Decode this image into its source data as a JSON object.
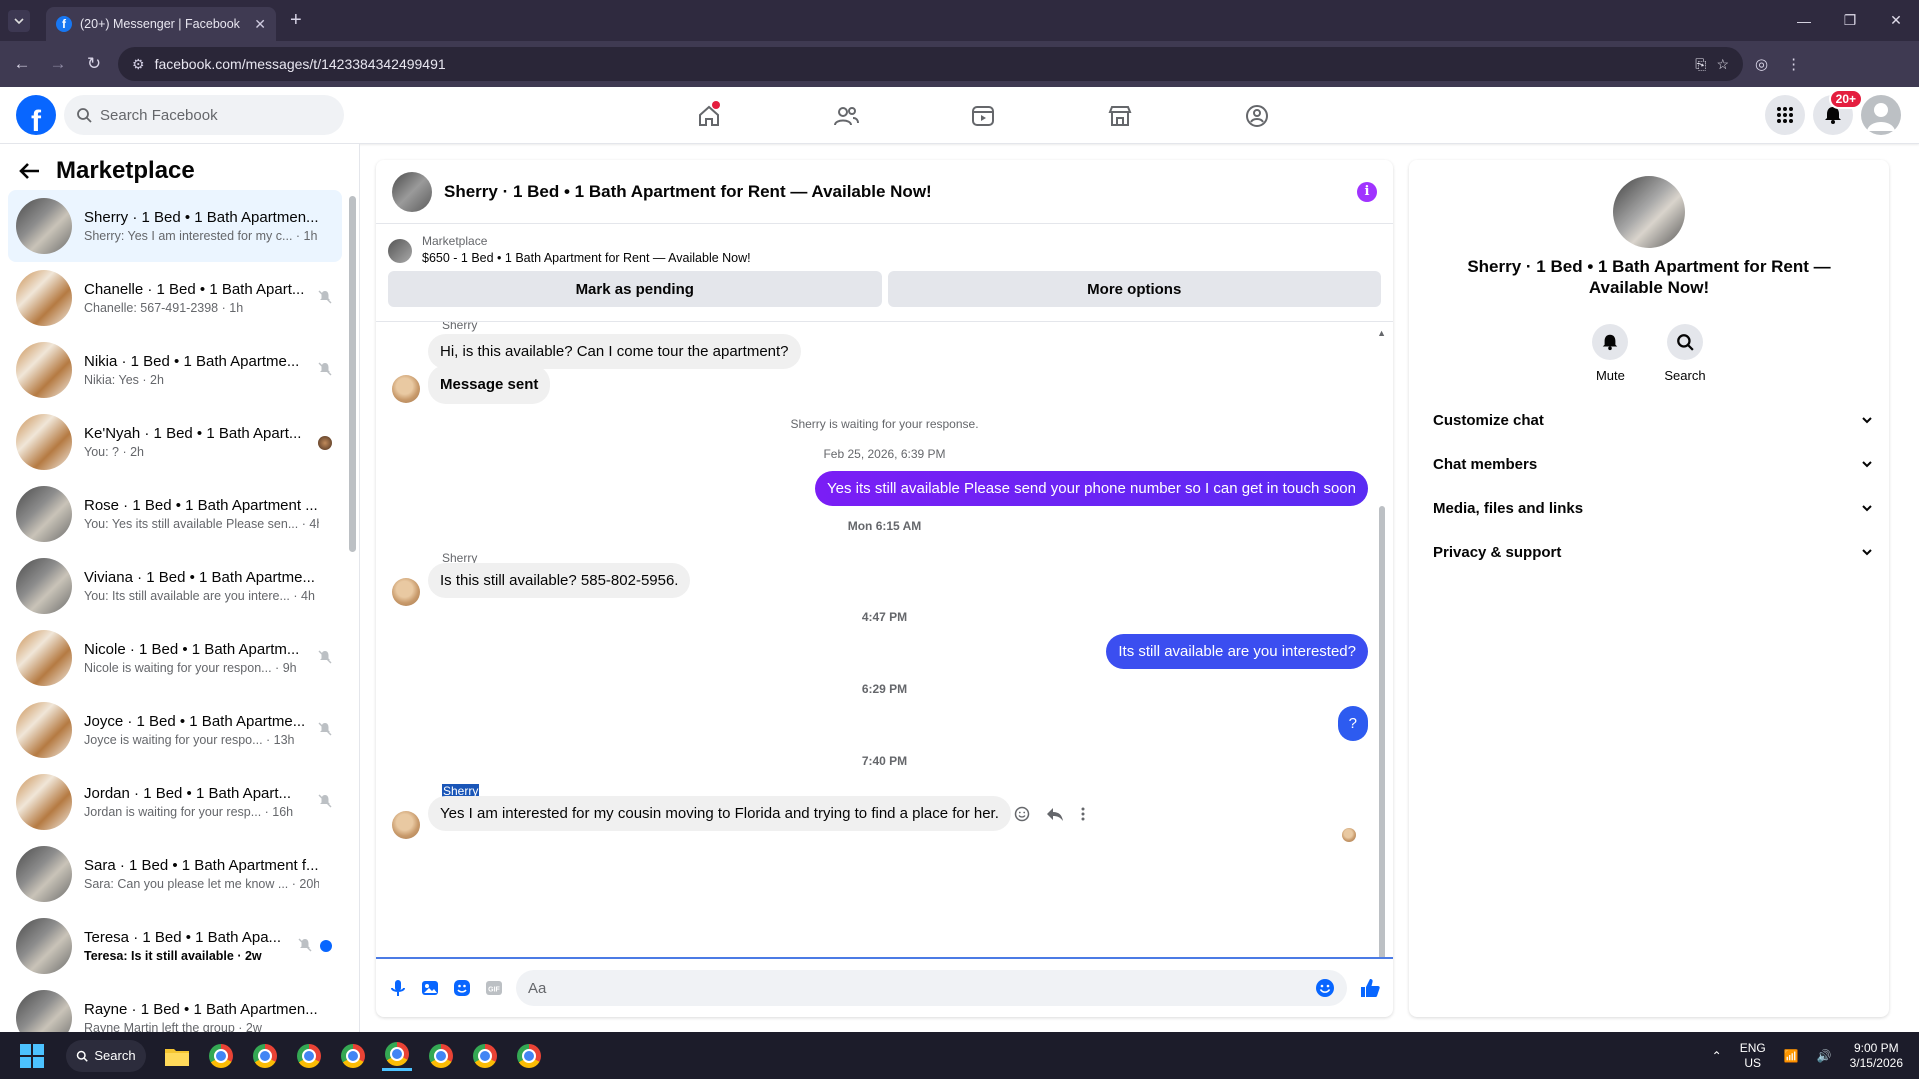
{
  "browser": {
    "tab_title": "(20+) Messenger | Facebook",
    "url": "facebook.com/messages/t/1423384342499491"
  },
  "header": {
    "search_placeholder": "Search Facebook",
    "notifications_badge": "20+"
  },
  "sidebar": {
    "title": "Marketplace",
    "conversations": [
      {
        "name": "Sherry · 1 Bed • 1 Bath Apartmen...",
        "preview": "Sherry: Yes I am interested for my c... · 1h",
        "active": true,
        "unread": false
      },
      {
        "name": "Chanelle · 1 Bed • 1 Bath Apart...",
        "preview": "Chanelle: 567-491-2398 · 1h",
        "active": false,
        "unread": false
      },
      {
        "name": "Nikia · 1 Bed • 1 Bath Apartme...",
        "preview": "Nikia: Yes · 2h",
        "active": false,
        "unread": false
      },
      {
        "name": "Ke'Nyah · 1 Bed • 1 Bath Apart...",
        "preview": "You: ? · 2h",
        "active": false,
        "unread": false
      },
      {
        "name": "Rose · 1 Bed • 1 Bath Apartment ...",
        "preview": "You: Yes its still available Please sen... · 4h",
        "active": false,
        "unread": false
      },
      {
        "name": "Viviana · 1 Bed • 1 Bath Apartme...",
        "preview": "You: Its still available are you intere... · 4h",
        "active": false,
        "unread": false
      },
      {
        "name": "Nicole · 1 Bed • 1 Bath Apartm...",
        "preview": "Nicole is waiting for your respon... · 9h",
        "active": false,
        "unread": false
      },
      {
        "name": "Joyce · 1 Bed • 1 Bath Apartme...",
        "preview": "Joyce is waiting for your respo... · 13h",
        "active": false,
        "unread": false
      },
      {
        "name": "Jordan · 1 Bed • 1 Bath Apart...",
        "preview": "Jordan is waiting for your resp... · 16h",
        "active": false,
        "unread": false
      },
      {
        "name": "Sara · 1 Bed • 1 Bath Apartment f...",
        "preview": "Sara: Can you please let me know ... · 20h",
        "active": false,
        "unread": false
      },
      {
        "name": "Teresa · 1 Bed • 1 Bath Apa...",
        "preview": "Teresa: Is it still available · 2w",
        "active": false,
        "unread": true
      },
      {
        "name": "Rayne · 1 Bed • 1 Bath Apartmen...",
        "preview": "Rayne Martin left the group · 2w",
        "active": false,
        "unread": false
      }
    ]
  },
  "chat": {
    "title": "Sherry · 1 Bed • 1 Bath Apartment for Rent — Available Now!",
    "marketplace_label": "Marketplace",
    "listing": "$650 - 1 Bed • 1 Bath Apartment for Rent — Available Now!",
    "mark_pending": "Mark as pending",
    "more_options": "More options",
    "sender_top": "Sherry",
    "msg1": "Hi, is this available? Can I come tour the apartment?",
    "msg2": "Message sent",
    "waiting_note": "Sherry is waiting for your response.",
    "ts1": "Feb 25, 2026, 6:39 PM",
    "msg3": "Yes its still available Please send your phone number so I can get in touch soon",
    "ts2": "Mon 6:15 AM",
    "sender2": "Sherry",
    "msg4": "Is this still available? 585-802-5956.",
    "ts3": "4:47 PM",
    "msg5": "Its still available are you interested?",
    "ts4": "6:29 PM",
    "msg6": "?",
    "ts5": "7:40 PM",
    "sender3": "Sherry",
    "msg7": "Yes I am interested for my cousin moving to Florida and trying to find a place for her.",
    "composer_placeholder": "Aa"
  },
  "details": {
    "name": "Sherry · 1 Bed • 1 Bath Apartment for Rent — Available Now!",
    "mute": "Mute",
    "search": "Search",
    "sections": [
      "Customize chat",
      "Chat members",
      "Media, files and links",
      "Privacy & support"
    ]
  },
  "taskbar": {
    "search": "Search",
    "lang1": "ENG",
    "lang2": "US",
    "time": "9:00 PM",
    "date": "3/15/2026"
  },
  "colors": {
    "accent": "#0866ff",
    "out_bubble_a": "#7a1ef5",
    "out_bubble_b": "#2d5bf0",
    "badge": "#e41e3f"
  }
}
